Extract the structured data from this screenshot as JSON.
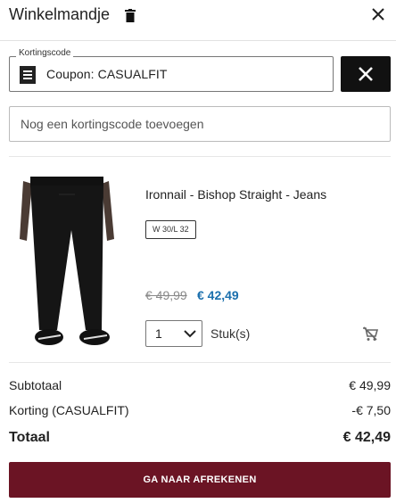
{
  "header": {
    "title": "Winkelmandje",
    "trash_icon": "trash-icon",
    "close_icon": "close-icon"
  },
  "coupon": {
    "legend": "Kortingscode",
    "value": "Coupon: CASUALFIT",
    "icon": "receipt-icon",
    "remove_icon": "close-icon"
  },
  "code_input": {
    "placeholder": "Nog een kortingscode toevoegen"
  },
  "item": {
    "name": "Ironnail - Bishop Straight - Jeans",
    "size": "W 30/L 32",
    "old_price": "€ 49,99",
    "new_price": "€ 42,49",
    "quantity": "1",
    "quantity_unit": "Stuk(s)",
    "remove_icon": "cart-remove-icon"
  },
  "summary": {
    "subtotal_label": "Subtotaal",
    "subtotal_value": "€ 49,99",
    "discount_label": "Korting (CASUALFIT)",
    "discount_value": "-€ 7,50",
    "total_label": "Totaal",
    "total_value": "€ 42,49"
  },
  "checkout": {
    "label": "GA NAAR AFREKENEN"
  },
  "colors": {
    "checkout_bg": "#6b1424",
    "sale_price": "#1a6fad",
    "remove_button_bg": "#111111"
  }
}
